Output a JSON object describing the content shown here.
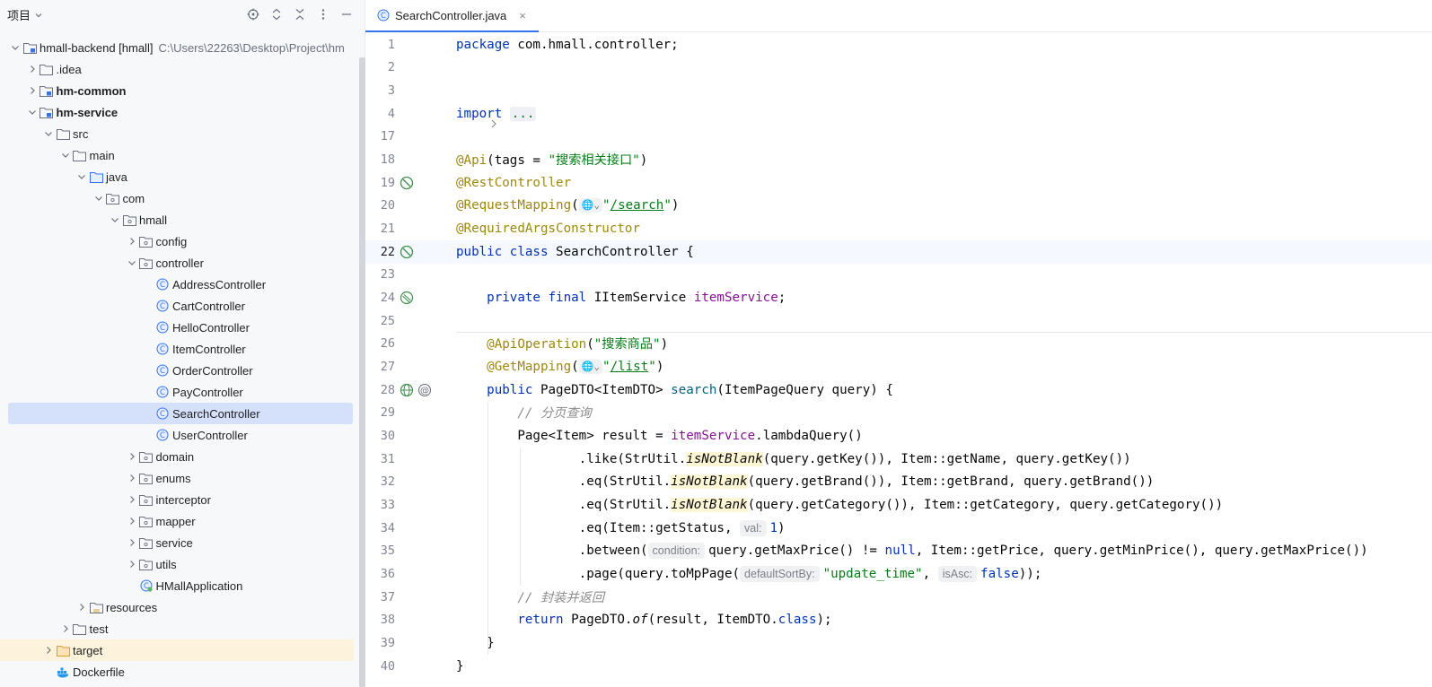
{
  "project_panel": {
    "title": "项目",
    "tree": [
      {
        "label": "hmall-backend [hmall]",
        "path": "C:\\Users\\22263\\Desktop\\Project\\hm",
        "depth": 0,
        "expanded": true,
        "icon": "module-folder-icon",
        "bold": false
      },
      {
        "label": ".idea",
        "depth": 1,
        "expanded": false,
        "icon": "folder-icon"
      },
      {
        "label": "hm-common",
        "depth": 1,
        "expanded": false,
        "icon": "module-folder-icon",
        "bold": true
      },
      {
        "label": "hm-service",
        "depth": 1,
        "expanded": true,
        "icon": "module-folder-icon",
        "bold": true
      },
      {
        "label": "src",
        "depth": 2,
        "expanded": true,
        "icon": "folder-icon"
      },
      {
        "label": "main",
        "depth": 3,
        "expanded": true,
        "icon": "folder-icon"
      },
      {
        "label": "java",
        "depth": 4,
        "expanded": true,
        "icon": "source-folder-icon"
      },
      {
        "label": "com",
        "depth": 5,
        "expanded": true,
        "icon": "package-icon"
      },
      {
        "label": "hmall",
        "depth": 6,
        "expanded": true,
        "icon": "package-icon"
      },
      {
        "label": "config",
        "depth": 7,
        "expanded": false,
        "icon": "package-icon"
      },
      {
        "label": "controller",
        "depth": 7,
        "expanded": true,
        "icon": "package-icon"
      },
      {
        "label": "AddressController",
        "depth": 8,
        "icon": "class-icon"
      },
      {
        "label": "CartController",
        "depth": 8,
        "icon": "class-icon"
      },
      {
        "label": "HelloController",
        "depth": 8,
        "icon": "class-icon"
      },
      {
        "label": "ItemController",
        "depth": 8,
        "icon": "class-icon"
      },
      {
        "label": "OrderController",
        "depth": 8,
        "icon": "class-icon"
      },
      {
        "label": "PayController",
        "depth": 8,
        "icon": "class-icon"
      },
      {
        "label": "SearchController",
        "depth": 8,
        "icon": "class-icon",
        "selected": true
      },
      {
        "label": "UserController",
        "depth": 8,
        "icon": "class-icon"
      },
      {
        "label": "domain",
        "depth": 7,
        "expanded": false,
        "icon": "package-icon"
      },
      {
        "label": "enums",
        "depth": 7,
        "expanded": false,
        "icon": "package-icon"
      },
      {
        "label": "interceptor",
        "depth": 7,
        "expanded": false,
        "icon": "package-icon"
      },
      {
        "label": "mapper",
        "depth": 7,
        "expanded": false,
        "icon": "package-icon"
      },
      {
        "label": "service",
        "depth": 7,
        "expanded": false,
        "icon": "package-icon"
      },
      {
        "label": "utils",
        "depth": 7,
        "expanded": false,
        "icon": "package-icon"
      },
      {
        "label": "HMallApplication",
        "depth": 7,
        "icon": "spring-app-icon"
      },
      {
        "label": "resources",
        "depth": 4,
        "expanded": false,
        "icon": "resources-folder-icon"
      },
      {
        "label": "test",
        "depth": 3,
        "expanded": false,
        "icon": "folder-icon"
      },
      {
        "label": "target",
        "depth": 2,
        "expanded": false,
        "icon": "excluded-folder-icon",
        "excluded": true
      },
      {
        "label": "Dockerfile",
        "depth": 2,
        "icon": "docker-icon"
      }
    ]
  },
  "editor": {
    "tab": {
      "label": "SearchController.java",
      "close": "×"
    },
    "lines": [
      {
        "no": "1"
      },
      {
        "no": "2"
      },
      {
        "no": "3"
      },
      {
        "no": "4"
      },
      {
        "no": "17"
      },
      {
        "no": "18"
      },
      {
        "no": "19"
      },
      {
        "no": "20"
      },
      {
        "no": "21"
      },
      {
        "no": "22"
      },
      {
        "no": "23"
      },
      {
        "no": "24"
      },
      {
        "no": "25"
      },
      {
        "no": "26"
      },
      {
        "no": "27"
      },
      {
        "no": "28"
      },
      {
        "no": "29"
      },
      {
        "no": "30"
      },
      {
        "no": "31"
      },
      {
        "no": "32"
      },
      {
        "no": "33"
      },
      {
        "no": "34"
      },
      {
        "no": "35"
      },
      {
        "no": "36"
      },
      {
        "no": "37"
      },
      {
        "no": "38"
      },
      {
        "no": "39"
      },
      {
        "no": "40"
      }
    ],
    "code": {
      "l1_kw": "package",
      "l1_rest": " com.hmall.controller;",
      "l4_kw": "import",
      "l4_dots": "...",
      "l18_ann": "@Api",
      "l18_a": "(tags = ",
      "l18_str": "\"搜索相关接口\"",
      "l18_b": ")",
      "l19_ann": "@RestController",
      "l20_ann": "@RequestMapping",
      "l20_a": "(",
      "l20_globe": "🌐⌄",
      "l20_q1": "\"",
      "l20_link": "/search",
      "l20_q2": "\"",
      "l20_b": ")",
      "l21_ann": "@RequiredArgsConstructor",
      "l22_kw": "public class",
      "l22_rest": " SearchController {",
      "l24_kw": "private final",
      "l24_type": " IItemService ",
      "l24_field": "itemService",
      "l24_end": ";",
      "l26_ann": "@ApiOperation",
      "l26_a": "(",
      "l26_str": "\"搜索商品\"",
      "l26_b": ")",
      "l27_ann": "@GetMapping",
      "l27_a": "(",
      "l27_globe": "🌐⌄",
      "l27_q1": "\"",
      "l27_link": "/list",
      "l27_q2": "\"",
      "l27_b": ")",
      "l28_kw": "public",
      "l28_a": " PageDTO<ItemDTO> ",
      "l28_method": "search",
      "l28_b": "(ItemPageQuery query) {",
      "l29_cmt": "// 分页查询",
      "l30_a": "Page<Item> result = ",
      "l30_field": "itemService",
      "l30_b": ".lambdaQuery()",
      "l31_a": ".like(StrUtil.",
      "l31_hl": "isNotBlank",
      "l31_b": "(query.getKey()), Item::getName, query.getKey())",
      "l32_a": ".eq(StrUtil.",
      "l32_hl": "isNotBlank",
      "l32_b": "(query.getBrand()), Item::getBrand, query.getBrand())",
      "l33_a": ".eq(StrUtil.",
      "l33_hl": "isNotBlank",
      "l33_b": "(query.getCategory()), Item::getCategory, query.getCategory())",
      "l34_a": ".eq(Item::getStatus, ",
      "l34_hint": "val:",
      "l34_num": "1",
      "l34_b": ")",
      "l35_a": ".between(",
      "l35_hint": "condition:",
      "l35_b": "query.getMaxPrice() != ",
      "l35_kw": "null",
      "l35_c": ", Item::getPrice, query.getMinPrice(), query.getMaxPrice())",
      "l36_a": ".page(query.toMpPage(",
      "l36_hint1": "defaultSortBy:",
      "l36_str": "\"update_time\"",
      "l36_b": ", ",
      "l36_hint2": "isAsc:",
      "l36_kw": "false",
      "l36_c": "));",
      "l37_cmt": "// 封装并返回",
      "l38_kw": "return",
      "l38_a": " PageDTO.",
      "l38_ital": "of",
      "l38_b": "(result, ItemDTO.",
      "l38_kw2": "class",
      "l38_c": ");",
      "l39": "}",
      "l40": "}"
    }
  },
  "colors": {
    "accent": "#3574f0",
    "keyword": "#0033b3",
    "annotation": "#9e880d",
    "string": "#067d17",
    "field": "#871094",
    "method": "#00627a",
    "comment": "#8c8c8c",
    "selection": "#d5e1fb"
  }
}
